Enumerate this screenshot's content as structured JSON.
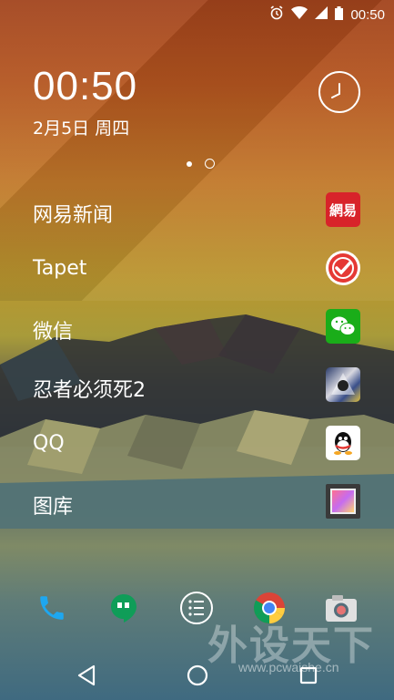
{
  "status_bar": {
    "time": "00:50"
  },
  "clock": {
    "time": "00:50",
    "date": "2月5日 周四"
  },
  "apps": [
    {
      "label": "网易新闻",
      "icon": "netease-news-icon",
      "icon_text": "網易"
    },
    {
      "label": "Tapet",
      "icon": "tapet-icon"
    },
    {
      "label": "微信",
      "icon": "wechat-icon"
    },
    {
      "label": "忍者必须死2",
      "icon": "ninja-game-icon"
    },
    {
      "label": "QQ",
      "icon": "qq-icon"
    },
    {
      "label": "图库",
      "icon": "gallery-icon"
    }
  ],
  "dock": [
    {
      "name": "phone-icon",
      "color": "#1ea7f0"
    },
    {
      "name": "hangouts-icon",
      "color": "#0f9d58"
    },
    {
      "name": "app-drawer-icon",
      "color": "#ffffff"
    },
    {
      "name": "chrome-icon",
      "color": "#db4437"
    },
    {
      "name": "camera-icon",
      "color": "#e0e0e0"
    }
  ],
  "watermark": {
    "text": "外设天下",
    "url": "www.pcwaishe.cn"
  }
}
